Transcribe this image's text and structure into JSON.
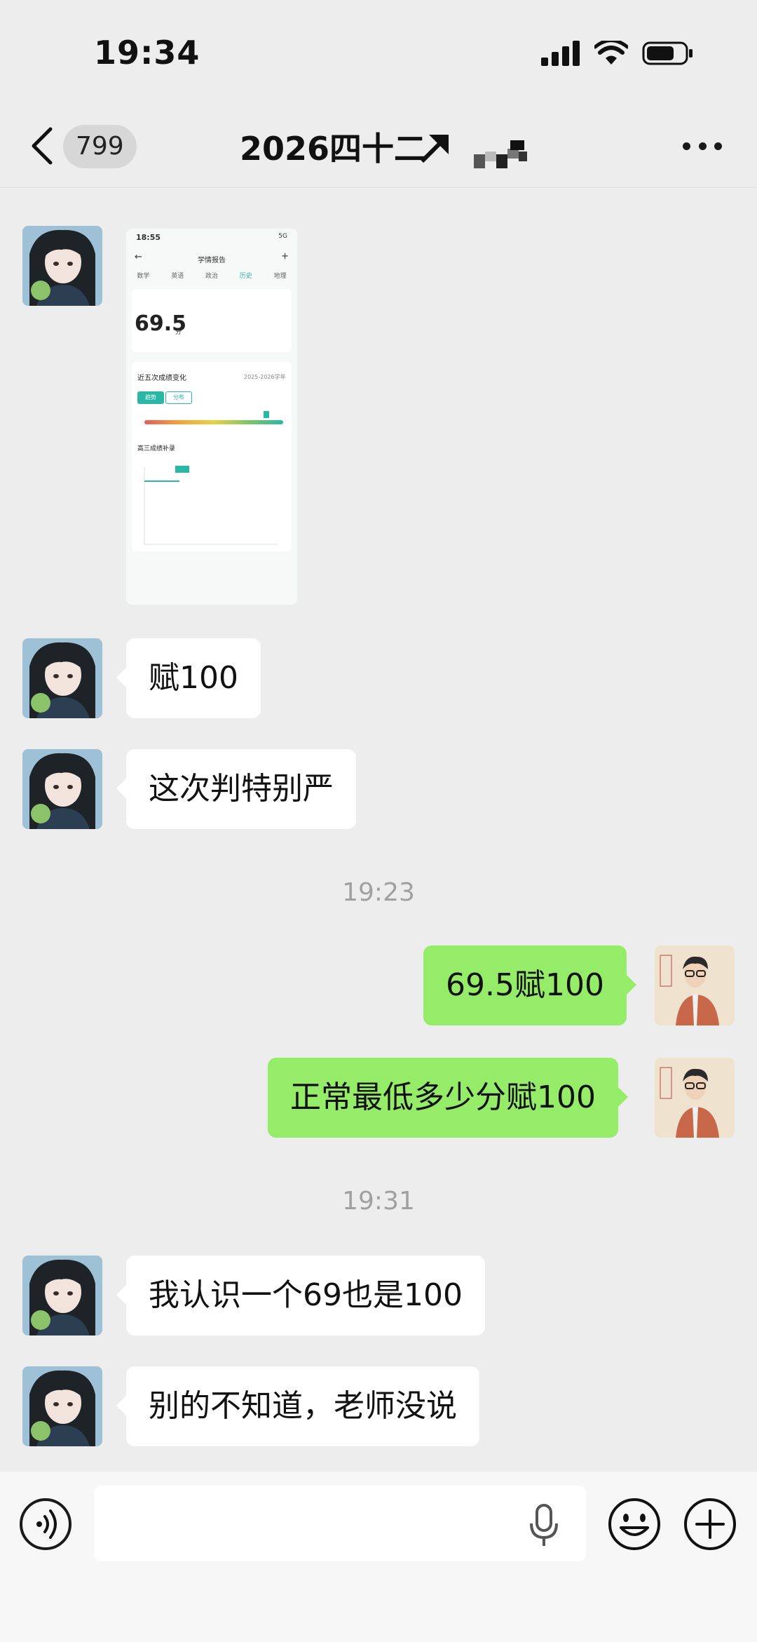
{
  "status_bar": {
    "time": "19:34"
  },
  "nav": {
    "unread_count": "799",
    "title": "2026四十二"
  },
  "chat": {
    "shared_screenshot": {
      "status_time": "18:55",
      "status_right": "5G",
      "title": "学情报告",
      "tabs": [
        "数学",
        "英语",
        "政治",
        "历史",
        "地理"
      ],
      "active_tab_index": 3,
      "score": "69.5",
      "score_unit": "分",
      "section_trend": "近五次成绩变化",
      "btn_on": "趋势",
      "btn_off": "分布",
      "section_detail": "高三成绩补录",
      "term_select": "2025-2026学年"
    },
    "messages": [
      {
        "type": "text",
        "side": "in",
        "text": "赋100"
      },
      {
        "type": "text",
        "side": "in",
        "text": "这次判特别严"
      },
      {
        "type": "time",
        "text": "19:23"
      },
      {
        "type": "text",
        "side": "out",
        "text": "69.5赋100"
      },
      {
        "type": "text",
        "side": "out",
        "text": "正常最低多少分赋100"
      },
      {
        "type": "time",
        "text": "19:31"
      },
      {
        "type": "text",
        "side": "in",
        "text": "我认识一个69也是100"
      },
      {
        "type": "text",
        "side": "in",
        "text": "别的不知道，老师没说"
      }
    ]
  },
  "colors": {
    "background": "#ededed",
    "bubble_out": "#95ec69",
    "bubble_in": "#ffffff",
    "accent_teal": "#2bb7a6"
  },
  "icons": {
    "back": "chevron-left-icon",
    "more": "ellipsis-icon",
    "voice": "voice-wave-icon",
    "mic": "microphone-icon",
    "emoji": "smiley-icon",
    "plus": "plus-circle-icon"
  }
}
